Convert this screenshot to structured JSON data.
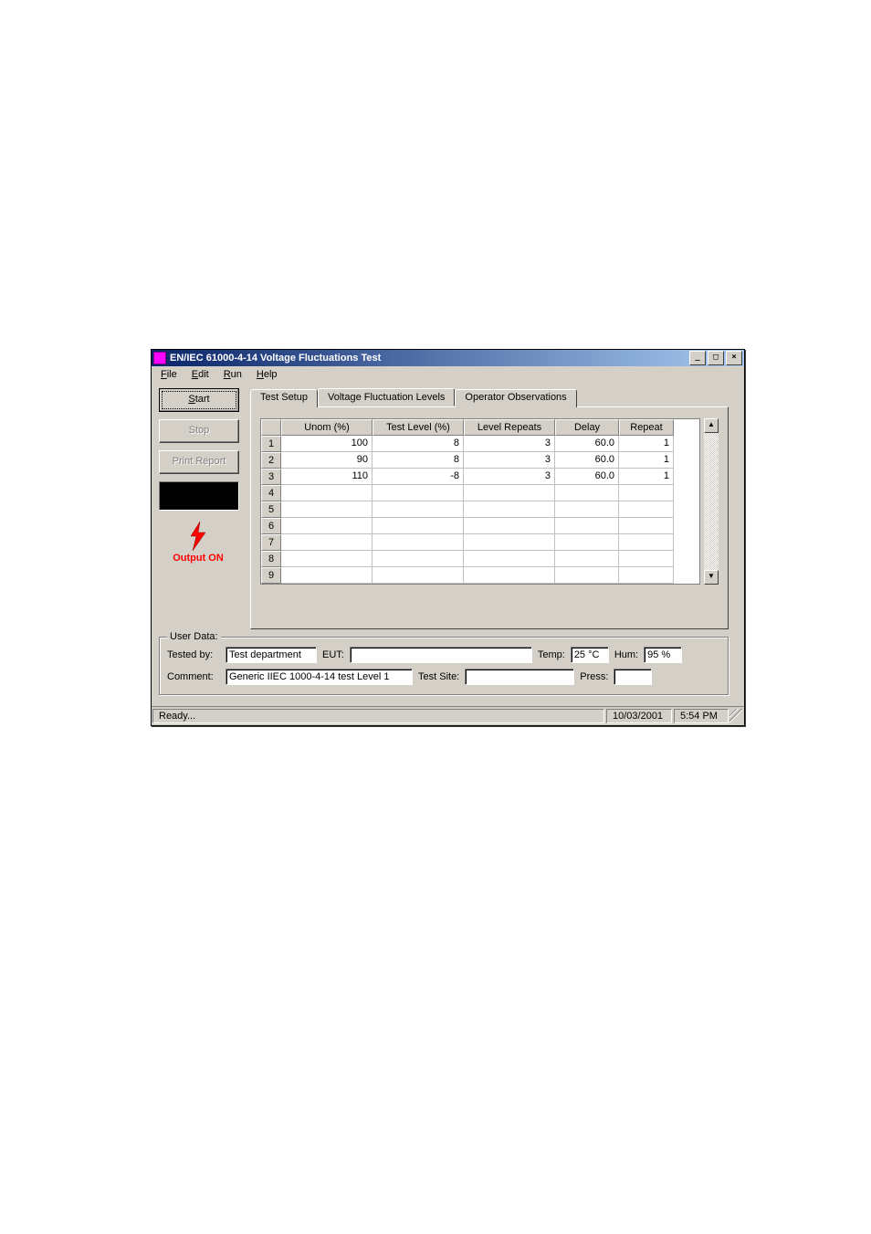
{
  "window": {
    "title": "EN/IEC 61000-4-14 Voltage Fluctuations Test"
  },
  "menu": {
    "file": "File",
    "edit": "Edit",
    "run": "Run",
    "help": "Help"
  },
  "sidebar": {
    "start": "Start",
    "stop": "Stop",
    "print": "Print Report",
    "output": "Output ON"
  },
  "tabs": {
    "setup": "Test Setup",
    "levels": "Voltage Fluctuation Levels",
    "obs": "Operator Observations"
  },
  "grid": {
    "headers": {
      "unom": "Unom (%)",
      "testlevel": "Test Level (%)",
      "levelrep": "Level Repeats",
      "delay": "Delay",
      "repeat": "Repeat"
    },
    "rows": [
      {
        "n": "1",
        "unom": "100",
        "tl": "8",
        "lr": "3",
        "delay": "60.0",
        "rep": "1"
      },
      {
        "n": "2",
        "unom": "90",
        "tl": "8",
        "lr": "3",
        "delay": "60.0",
        "rep": "1"
      },
      {
        "n": "3",
        "unom": "110",
        "tl": "-8",
        "lr": "3",
        "delay": "60.0",
        "rep": "1"
      },
      {
        "n": "4",
        "unom": "",
        "tl": "",
        "lr": "",
        "delay": "",
        "rep": ""
      },
      {
        "n": "5",
        "unom": "",
        "tl": "",
        "lr": "",
        "delay": "",
        "rep": ""
      },
      {
        "n": "6",
        "unom": "",
        "tl": "",
        "lr": "",
        "delay": "",
        "rep": ""
      },
      {
        "n": "7",
        "unom": "",
        "tl": "",
        "lr": "",
        "delay": "",
        "rep": ""
      },
      {
        "n": "8",
        "unom": "",
        "tl": "",
        "lr": "",
        "delay": "",
        "rep": ""
      },
      {
        "n": "9",
        "unom": "",
        "tl": "",
        "lr": "",
        "delay": "",
        "rep": ""
      }
    ]
  },
  "userdata": {
    "legend": "User Data:",
    "testedby_lbl": "Tested by:",
    "testedby": "Test department",
    "eut_lbl": "EUT:",
    "eut": "",
    "temp_lbl": "Temp:",
    "temp": "25 °C",
    "hum_lbl": "Hum:",
    "hum": "95 %",
    "comment_lbl": "Comment:",
    "comment": "Generic IIEC 1000-4-14 test Level 1",
    "testsite_lbl": "Test Site:",
    "testsite": "",
    "press_lbl": "Press:",
    "press": ""
  },
  "status": {
    "msg": "Ready...",
    "date": "10/03/2001",
    "time": "5:54 PM"
  }
}
